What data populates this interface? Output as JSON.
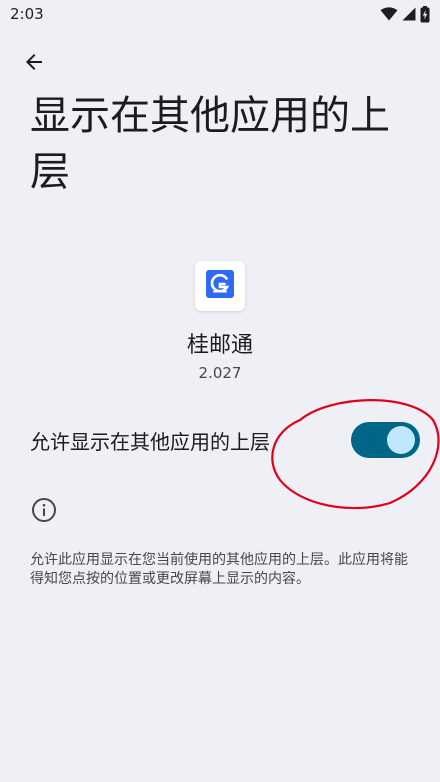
{
  "status_bar": {
    "time": "2:03"
  },
  "header": {
    "back_icon": "arrow-left-icon",
    "title": "显示在其他应用的上层"
  },
  "app": {
    "icon": "guiyoutong-app-icon",
    "name": "桂邮通",
    "version": "2.027"
  },
  "permission": {
    "label": "允许显示在其他应用的上层",
    "enabled": true
  },
  "info": {
    "icon": "info-icon",
    "description": "允许此应用显示在您当前使用的其他应用的上层。此应用将能得知您点按的位置或更改屏幕上显示的内容。"
  },
  "colors": {
    "background": "#eff0f5",
    "toggle_track": "#006687",
    "toggle_thumb": "#c0e8fc",
    "annotation": "#e0001b",
    "app_icon_blue": "#2d6bf5"
  }
}
